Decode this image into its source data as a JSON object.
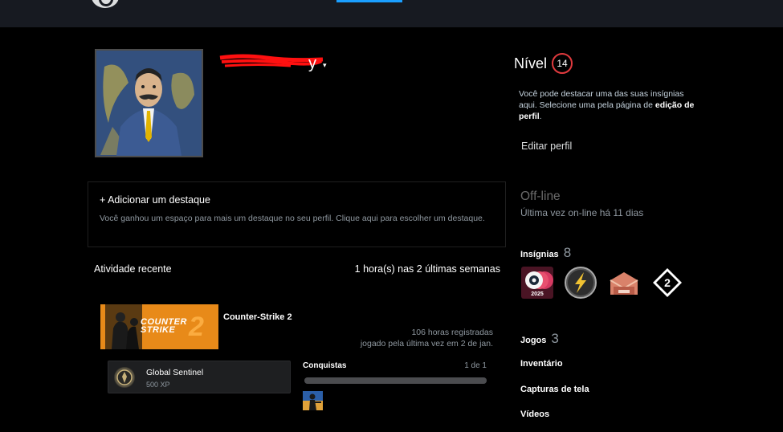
{
  "topbar": {
    "logo_icon": "steam-logo-icon",
    "active_tab_color": "#1a9fff"
  },
  "profile": {
    "persona_visible_fragment": "y",
    "persona_redacted": true,
    "caret_glyph": "▾"
  },
  "level": {
    "label": "Nível",
    "value": "14",
    "ring_color": "#e03a3e"
  },
  "badge_hint": {
    "text_before": "Você pode destacar uma das suas insígnias aqui. Selecione uma pela página de ",
    "link_text": "edição de perfil",
    "text_after": "."
  },
  "edit_profile_label": "Editar perfil",
  "showcase": {
    "title": "+ Adicionar um destaque",
    "description": "Você ganhou um espaço para mais um destaque no seu perfil. Clique aqui para escolher um destaque."
  },
  "status": {
    "title": "Off-line",
    "subtitle": "Última vez on-line há 11 dias"
  },
  "recent_activity": {
    "label": "Atividade recente",
    "hours_summary": "1 hora(s) nas 2 últimas semanas",
    "game": {
      "name": "Counter-Strike 2",
      "capsule_text_line1": "COUNTER",
      "capsule_text_line2": "STRIKE",
      "capsule_number": "2",
      "hours_recorded": "106 horas registradas",
      "last_played": "jogado pela última vez em 2 de jan."
    },
    "achievement": {
      "name": "Global Sentinel",
      "xp": "500 XP",
      "icon": "global-sentinel-medal-icon"
    },
    "conquistas": {
      "label": "Conquistas",
      "count": "1 de 1",
      "progress": 1.0,
      "thumb_icon": "cs-achievement-thumb-icon"
    }
  },
  "sidebar": {
    "insignias": {
      "label": "Insígnias",
      "count": "8"
    },
    "badge_year_text": "2025",
    "badge_icons": [
      "steam-2025-badge-icon",
      "lightning-badge-icon",
      "mail-package-badge-icon",
      "level-2-diamond-badge-icon"
    ],
    "badge_diamond_number": "2",
    "jogos": {
      "label": "Jogos",
      "count": "3"
    },
    "links": [
      "Inventário",
      "Capturas de tela",
      "Vídeos"
    ]
  }
}
